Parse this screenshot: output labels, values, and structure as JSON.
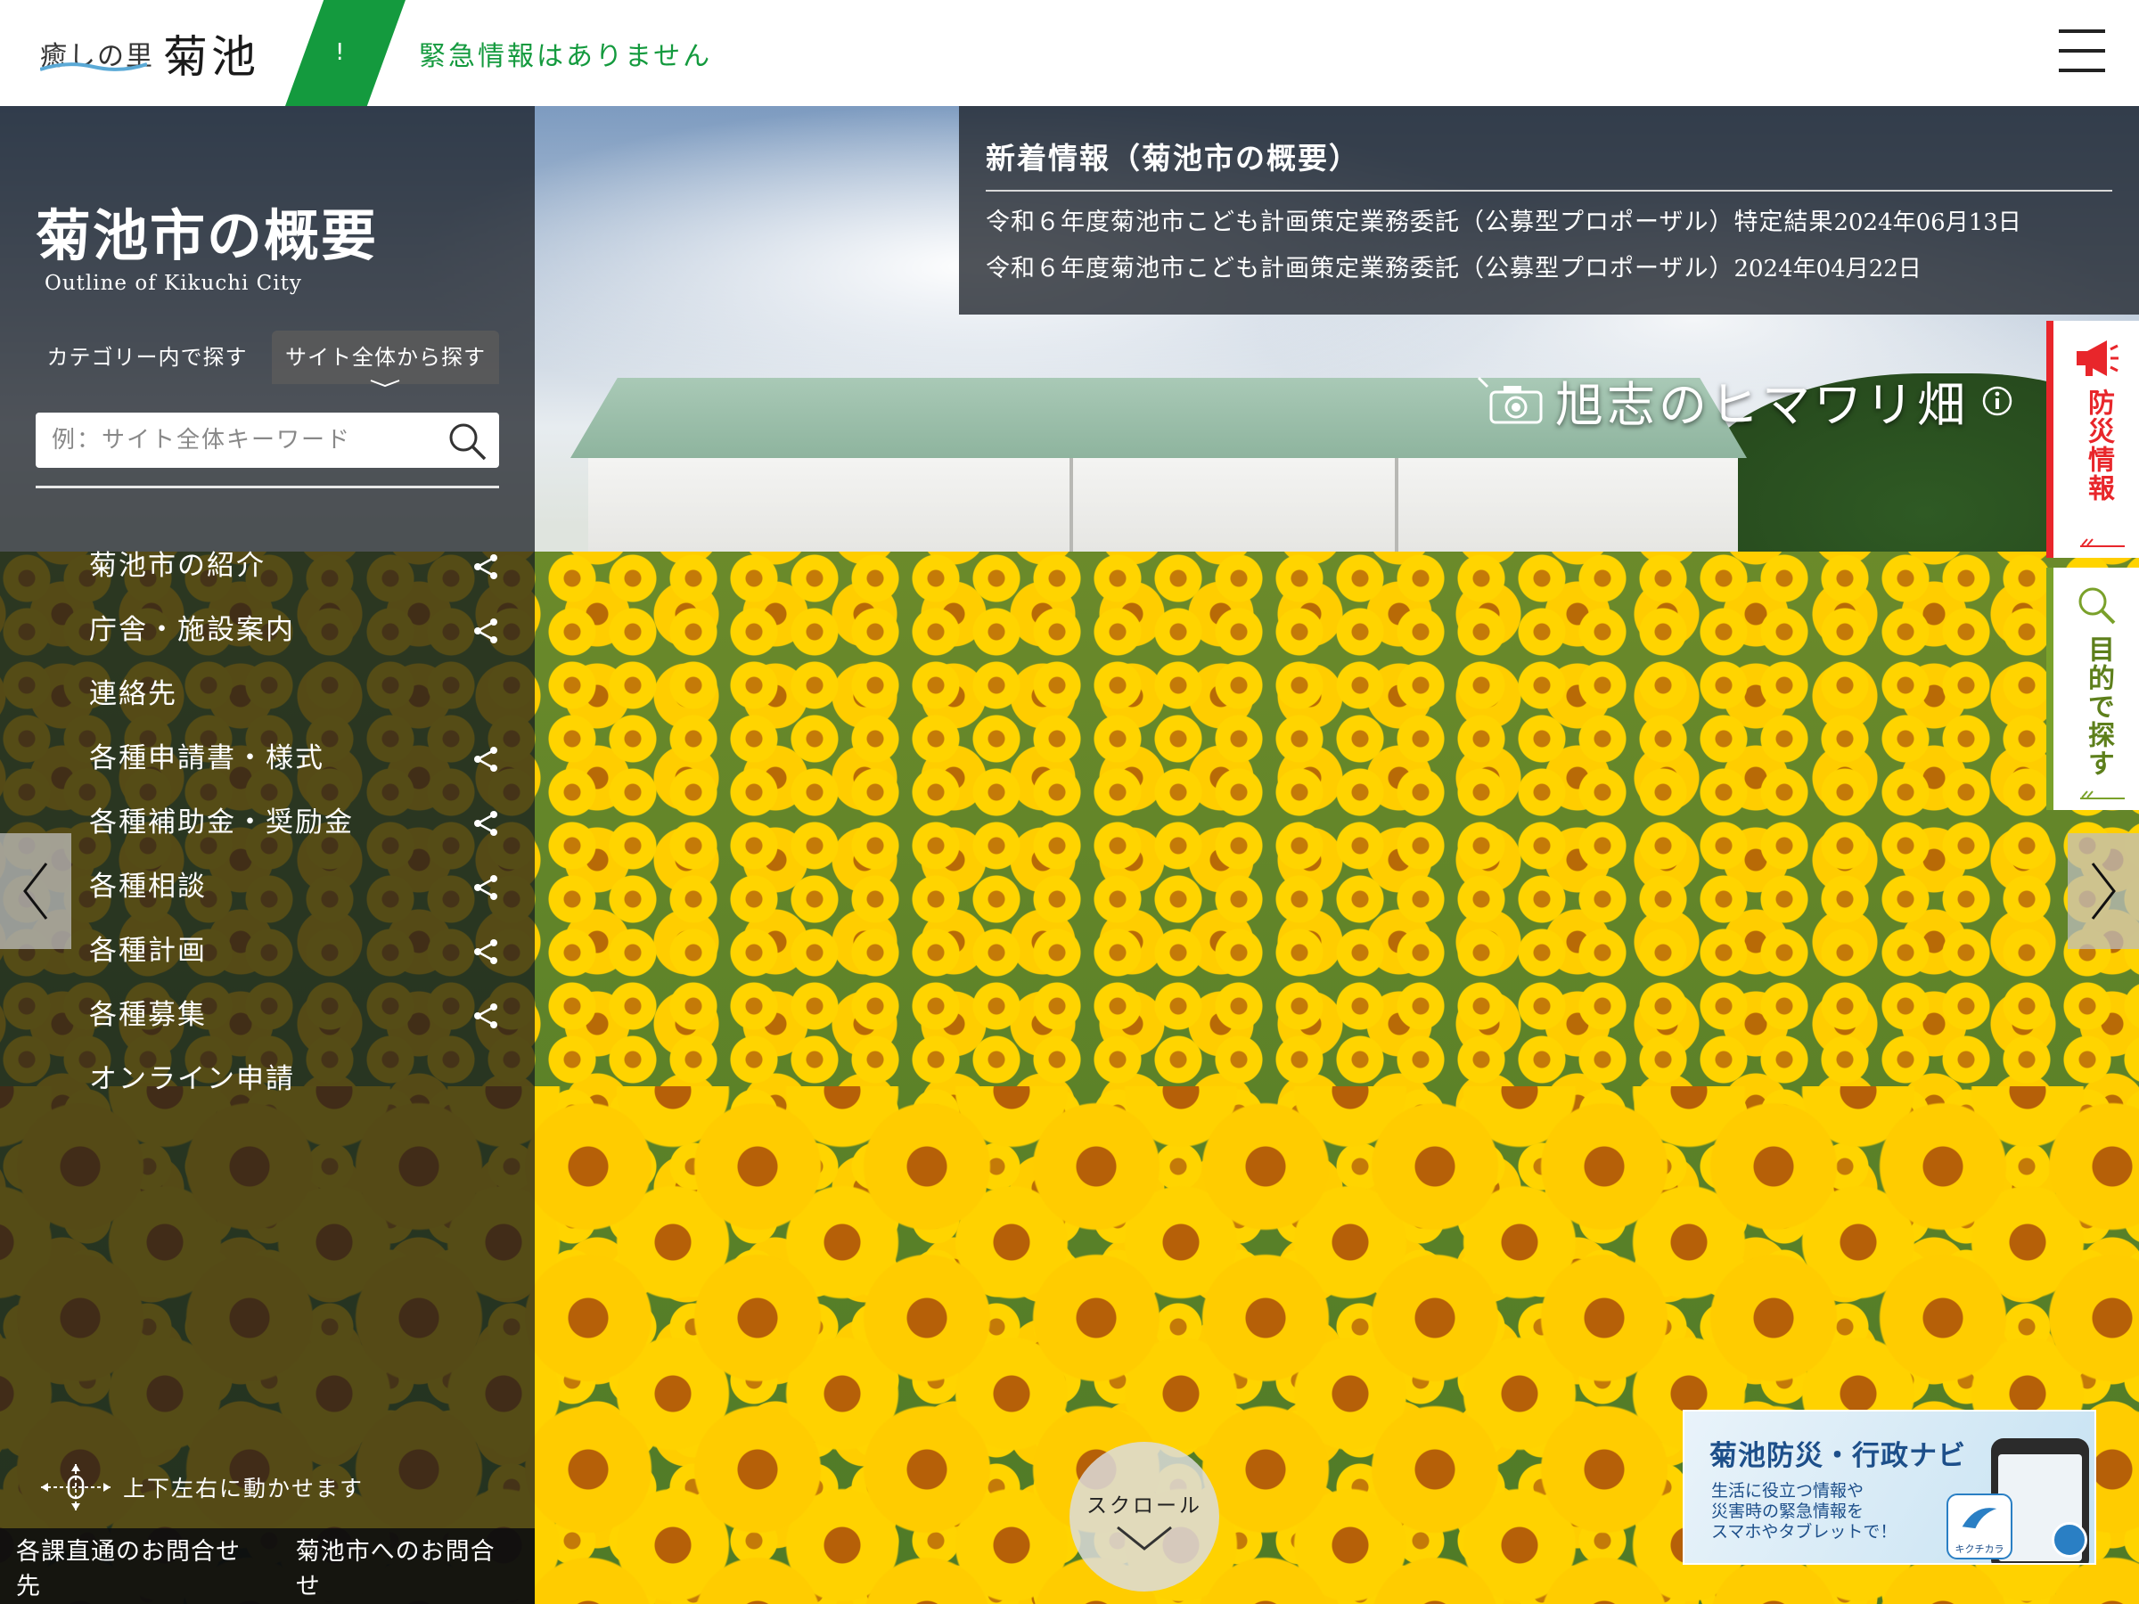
{
  "header": {
    "logo_small": "癒しの里",
    "logo_big": "菊池",
    "alert_mark": "!",
    "alert_text": "緊急情報はありません"
  },
  "section": {
    "title": "菊池市の概要",
    "subtitle": "Outline of Kikuchi City"
  },
  "search": {
    "tab_category": "カテゴリー内で探す",
    "tab_site": "サイト全体から探す",
    "placeholder": "例：サイト全体キーワード"
  },
  "nav": {
    "items": [
      {
        "label": "菊池市の紹介"
      },
      {
        "label": "庁舎・施設案内"
      },
      {
        "label": "連絡先"
      },
      {
        "label": "各種申請書・様式"
      },
      {
        "label": "各種補助金・奨励金"
      },
      {
        "label": "各種相談"
      },
      {
        "label": "各種計画"
      },
      {
        "label": "各種募集"
      },
      {
        "label": "オンライン申請"
      }
    ]
  },
  "move_hint": "上下左右に動かせます",
  "footer": {
    "link1": "各課直通のお問合せ先",
    "link2": "菊池市へのお問合せ"
  },
  "news": {
    "heading": "新着情報（菊池市の概要）",
    "items": [
      {
        "title": "令和６年度菊池市こども計画策定業務委託（公募型プロポーザル）特定結果",
        "date": "2024年06月13日"
      },
      {
        "title": "令和６年度菊池市こども計画策定業務委託（公募型プロポーザル）",
        "date": "2024年04月22日"
      }
    ]
  },
  "caption": "旭志のヒマワリ畑",
  "side_tabs": {
    "bosai": "防災情報",
    "mokuteki": "目的で探す"
  },
  "scroll_label": "スクロール",
  "app_banner": {
    "title": "菊池防災・行政ナビ",
    "desc": "生活に役立つ情報や\n災害時の緊急情報を\nスマホやタブレットで！",
    "logo_text": "キクチカラ"
  },
  "colors": {
    "accent_green": "#149a3e",
    "bosai_red": "#e8262b",
    "mokuteki_green": "#7aa12a"
  },
  "icons": [
    "menu-icon",
    "search-icon",
    "share-icon",
    "move-icon",
    "camera-icon",
    "info-icon",
    "megaphone-icon",
    "chevron-left-icon",
    "chevron-right-icon",
    "chevron-down-icon"
  ]
}
